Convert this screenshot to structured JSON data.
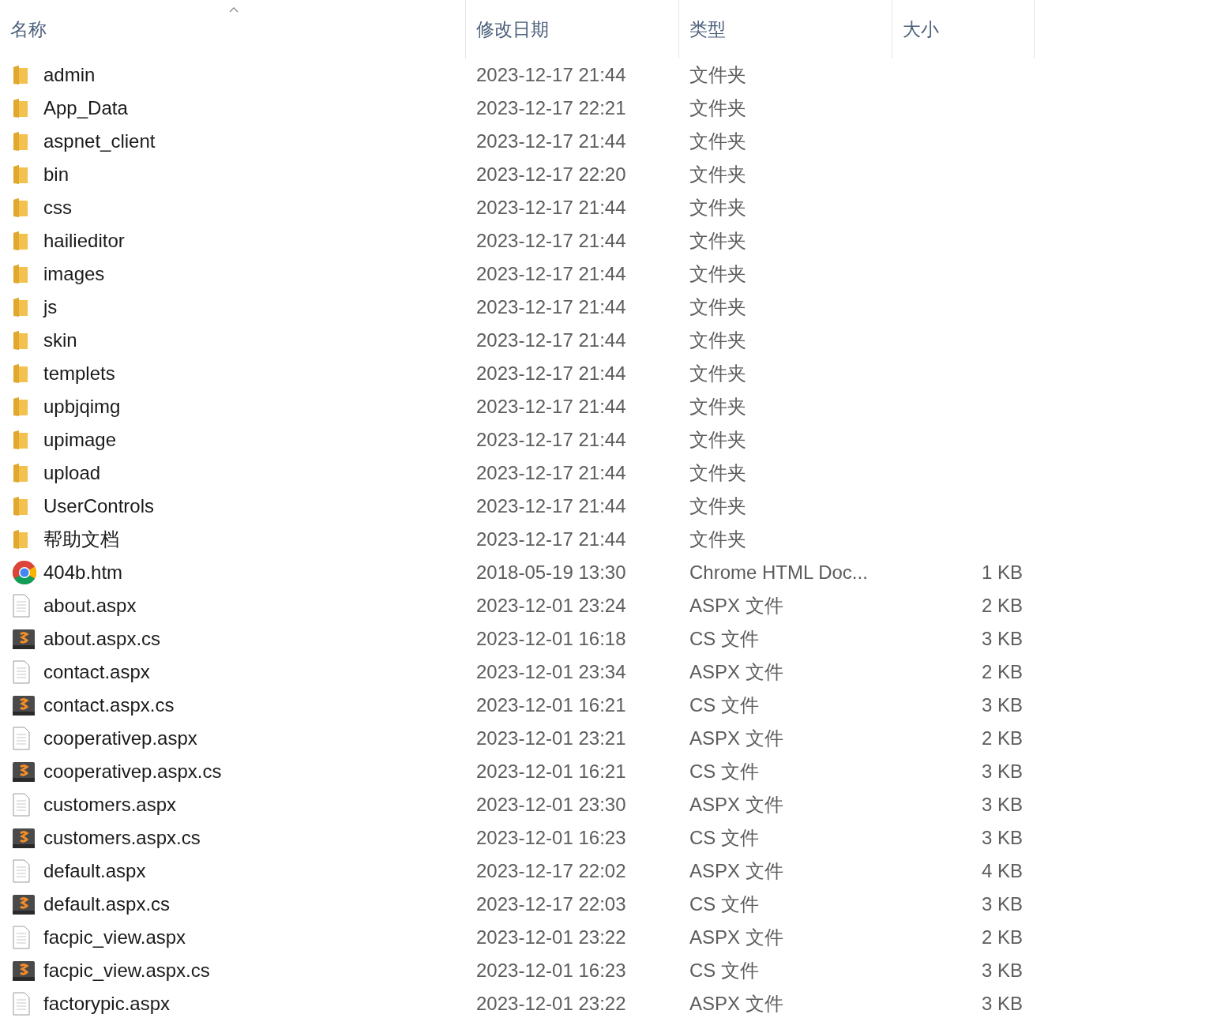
{
  "columns": [
    {
      "label": "名称",
      "sorted": true
    },
    {
      "label": "修改日期",
      "sorted": false
    },
    {
      "label": "类型",
      "sorted": false
    },
    {
      "label": "大小",
      "sorted": false
    }
  ],
  "rows": [
    {
      "kind": "folder",
      "name": "admin",
      "modified": "2023-12-17 21:44",
      "type": "文件夹"
    },
    {
      "kind": "folder",
      "name": "App_Data",
      "modified": "2023-12-17 22:21",
      "type": "文件夹"
    },
    {
      "kind": "folder",
      "name": "aspnet_client",
      "modified": "2023-12-17 21:44",
      "type": "文件夹"
    },
    {
      "kind": "folder",
      "name": "bin",
      "modified": "2023-12-17 22:20",
      "type": "文件夹"
    },
    {
      "kind": "folder",
      "name": "css",
      "modified": "2023-12-17 21:44",
      "type": "文件夹"
    },
    {
      "kind": "folder",
      "name": "hailieditor",
      "modified": "2023-12-17 21:44",
      "type": "文件夹"
    },
    {
      "kind": "folder",
      "name": "images",
      "modified": "2023-12-17 21:44",
      "type": "文件夹"
    },
    {
      "kind": "folder",
      "name": "js",
      "modified": "2023-12-17 21:44",
      "type": "文件夹"
    },
    {
      "kind": "folder",
      "name": "skin",
      "modified": "2023-12-17 21:44",
      "type": "文件夹"
    },
    {
      "kind": "folder",
      "name": "templets",
      "modified": "2023-12-17 21:44",
      "type": "文件夹"
    },
    {
      "kind": "folder",
      "name": "upbjqimg",
      "modified": "2023-12-17 21:44",
      "type": "文件夹"
    },
    {
      "kind": "folder",
      "name": "upimage",
      "modified": "2023-12-17 21:44",
      "type": "文件夹"
    },
    {
      "kind": "folder",
      "name": "upload",
      "modified": "2023-12-17 21:44",
      "type": "文件夹"
    },
    {
      "kind": "folder",
      "name": "UserControls",
      "modified": "2023-12-17 21:44",
      "type": "文件夹"
    },
    {
      "kind": "folder",
      "name": "帮助文档",
      "modified": "2023-12-17 21:44",
      "type": "文件夹"
    },
    {
      "kind": "browser",
      "name": "404b.htm",
      "modified": "2018-05-19 13:30",
      "type": "Chrome HTML Doc...",
      "size": "1 KB"
    },
    {
      "kind": "document",
      "name": "about.aspx",
      "modified": "2023-12-01 23:24",
      "type": "ASPX 文件",
      "size": "2 KB"
    },
    {
      "kind": "script",
      "name": "about.aspx.cs",
      "modified": "2023-12-01 16:18",
      "type": "CS 文件",
      "size": "3 KB"
    },
    {
      "kind": "document",
      "name": "contact.aspx",
      "modified": "2023-12-01 23:34",
      "type": "ASPX 文件",
      "size": "2 KB"
    },
    {
      "kind": "script",
      "name": "contact.aspx.cs",
      "modified": "2023-12-01 16:21",
      "type": "CS 文件",
      "size": "3 KB"
    },
    {
      "kind": "document",
      "name": "cooperativep.aspx",
      "modified": "2023-12-01 23:21",
      "type": "ASPX 文件",
      "size": "2 KB"
    },
    {
      "kind": "script",
      "name": "cooperativep.aspx.cs",
      "modified": "2023-12-01 16:21",
      "type": "CS 文件",
      "size": "3 KB"
    },
    {
      "kind": "document",
      "name": "customers.aspx",
      "modified": "2023-12-01 23:30",
      "type": "ASPX 文件",
      "size": "3 KB"
    },
    {
      "kind": "script",
      "name": "customers.aspx.cs",
      "modified": "2023-12-01 16:23",
      "type": "CS 文件",
      "size": "3 KB"
    },
    {
      "kind": "document",
      "name": "default.aspx",
      "modified": "2023-12-17 22:02",
      "type": "ASPX 文件",
      "size": "4 KB"
    },
    {
      "kind": "script",
      "name": "default.aspx.cs",
      "modified": "2023-12-17 22:03",
      "type": "CS 文件",
      "size": "3 KB"
    },
    {
      "kind": "document",
      "name": "facpic_view.aspx",
      "modified": "2023-12-01 23:22",
      "type": "ASPX 文件",
      "size": "2 KB"
    },
    {
      "kind": "script",
      "name": "facpic_view.aspx.cs",
      "modified": "2023-12-01 16:23",
      "type": "CS 文件",
      "size": "3 KB"
    },
    {
      "kind": "document",
      "name": "factorypic.aspx",
      "modified": "2023-12-01 23:22",
      "type": "ASPX 文件",
      "size": "3 KB"
    }
  ]
}
